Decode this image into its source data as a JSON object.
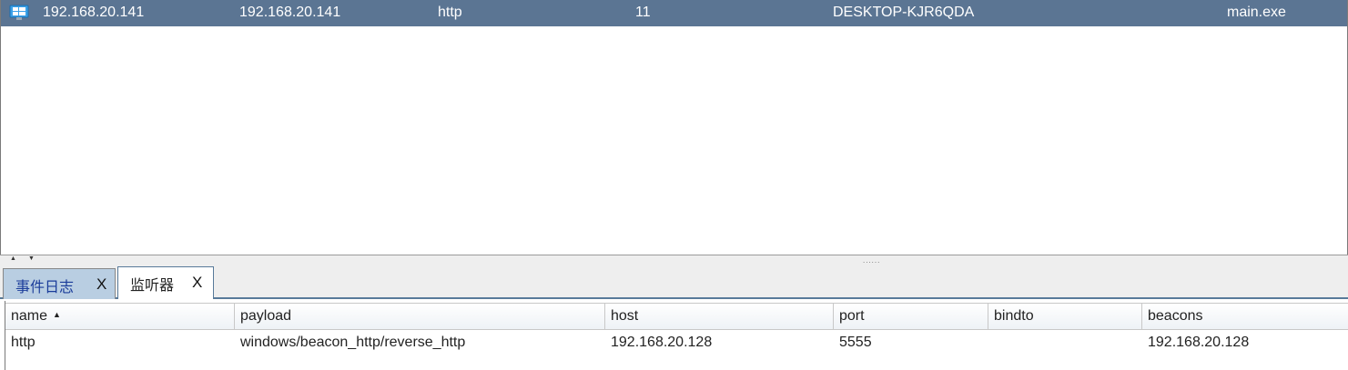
{
  "sessions": {
    "rows": [
      {
        "icon": "windows-icon",
        "external": "192.168.20.141",
        "internal": "192.168.20.141",
        "listener": "http",
        "pid": "11",
        "computer": "DESKTOP-KJR6QDA",
        "process": "main.exe"
      }
    ]
  },
  "divider": {
    "grip": "......",
    "arrow_up": "▲",
    "arrow_down": "▼"
  },
  "tabs": [
    {
      "label": "事件日志",
      "close": "X"
    },
    {
      "label": "监听器",
      "close": "X"
    }
  ],
  "listeners": {
    "columns": [
      "name",
      "payload",
      "host",
      "port",
      "bindto",
      "beacons"
    ],
    "sort_icon": "▲",
    "rows": [
      {
        "name": "http",
        "payload": "windows/beacon_http/reverse_http",
        "host": "192.168.20.128",
        "port": "5555",
        "bindto": "",
        "beacons": "192.168.20.128"
      }
    ]
  },
  "colors": {
    "selected_row": "#5b7593",
    "tab_inactive": "#b9cee2",
    "tab_active_border": "#587a9a"
  }
}
